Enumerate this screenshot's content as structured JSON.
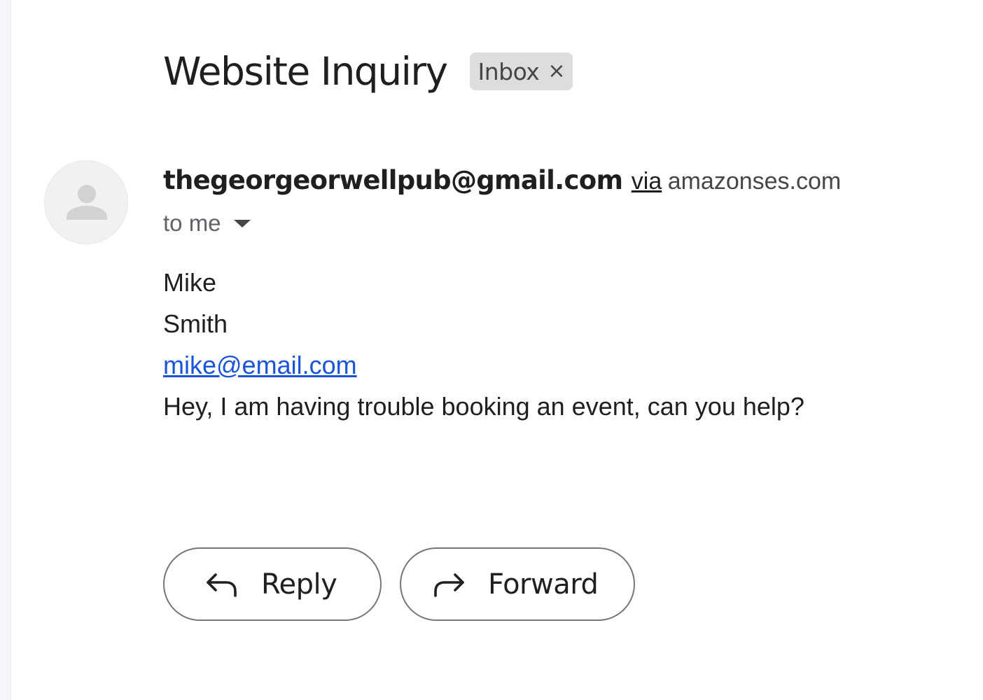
{
  "email": {
    "subject": "Website Inquiry",
    "label": "Inbox",
    "label_remove_glyph": "×",
    "sender": {
      "address": "thegeorgeorwellpub@gmail.com",
      "via_text": "via",
      "via_domain": "amazonses.com",
      "avatar_icon": "person-icon"
    },
    "recipient_text": "to me",
    "body_lines": [
      "Mike",
      "Smith",
      "mike@email.com",
      "Hey, I am having trouble booking an event, can you help?"
    ]
  },
  "actions": {
    "reply_label": "Reply",
    "reply_icon": "reply-arrow-icon",
    "forward_label": "Forward",
    "forward_icon": "forward-arrow-icon"
  },
  "colors": {
    "link": "#1a55d9",
    "chip_bg": "#dddddd",
    "button_border": "#747775",
    "avatar_bg": "#f1f1f1"
  }
}
